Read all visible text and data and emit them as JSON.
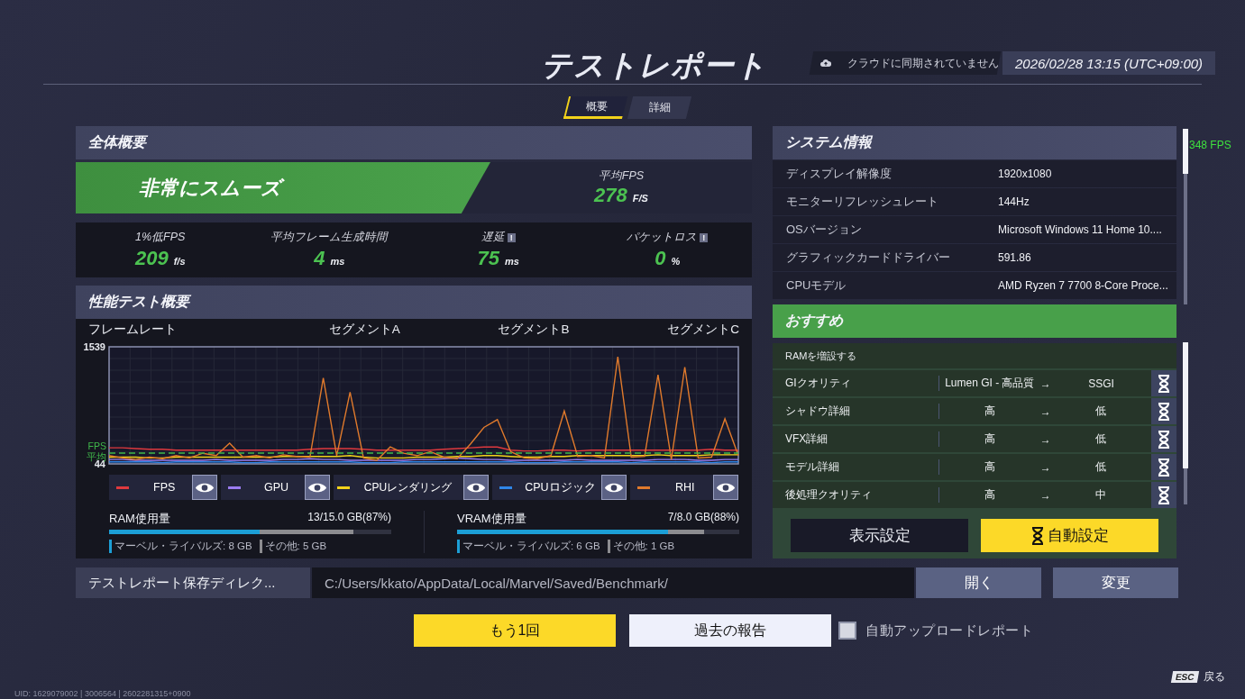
{
  "header": {
    "title": "テストレポート",
    "cloud_status": "クラウドに同期されていません",
    "datetime": "2026/02/28 13:15 (UTC+09:00)"
  },
  "tabs": [
    {
      "label": "概要",
      "selected": true
    },
    {
      "label": "詳細",
      "selected": false
    }
  ],
  "overview": {
    "title": "全体概要",
    "rating": "非常にスムーズ",
    "avg_fps": {
      "label": "平均FPS",
      "value": "278",
      "unit": "F/S"
    },
    "stats": [
      {
        "label": "1%低FPS",
        "value": "209",
        "unit": "f/s"
      },
      {
        "label": "平均フレーム生成時間",
        "value": "4",
        "unit": "ms"
      },
      {
        "label": "遅延",
        "badge": "!",
        "value": "75",
        "unit": "ms"
      },
      {
        "label": "パケットロス",
        "badge": "!",
        "value": "0",
        "unit": "%"
      }
    ]
  },
  "performance": {
    "title": "性能テスト概要",
    "average_label": "FPS 平均",
    "segments": [
      "セグメントA",
      "セグメントB",
      "セグメントC"
    ],
    "chart_data": {
      "type": "line",
      "title": "フレームレート",
      "ylim": [
        44,
        1539
      ],
      "yticks": [
        44,
        1539
      ],
      "grid": true,
      "series": [
        {
          "name": "FPS",
          "color": "#e0393e",
          "values": [
            250,
            250,
            240,
            230,
            230,
            220,
            220,
            220,
            220,
            220,
            220,
            220,
            220,
            220,
            220,
            230,
            240,
            240,
            240,
            230,
            220,
            220,
            220,
            220,
            220,
            230,
            240,
            250,
            260,
            260,
            220,
            210,
            210,
            220,
            220,
            210,
            220,
            220,
            220,
            220,
            220,
            220,
            220,
            220,
            220,
            230,
            220,
            220
          ]
        },
        {
          "name": "GPU",
          "color": "#9b7cf0",
          "values": [
            100,
            100,
            90,
            90,
            90,
            90,
            90,
            90,
            100,
            90,
            90,
            90,
            90,
            100,
            100,
            110,
            100,
            100,
            90,
            90,
            90,
            90,
            90,
            100,
            100,
            110,
            120,
            110,
            100,
            100,
            90,
            90,
            90,
            90,
            90,
            100,
            90,
            90,
            90,
            90,
            90,
            100,
            100,
            100,
            90,
            90,
            100,
            100
          ]
        },
        {
          "name": "CPUレンダリング",
          "color": "#f2d21b",
          "values": [
            130,
            130,
            130,
            120,
            120,
            130,
            130,
            130,
            130,
            130,
            130,
            130,
            130,
            140,
            140,
            140,
            140,
            140,
            150,
            130,
            120,
            120,
            120,
            130,
            130,
            130,
            140,
            140,
            150,
            150,
            140,
            130,
            130,
            140,
            140,
            150,
            150,
            150,
            150,
            150,
            150,
            160,
            150,
            150,
            150,
            160,
            160,
            160
          ]
        },
        {
          "name": "CPUロジック",
          "color": "#2f86e8",
          "values": [
            70,
            70,
            70,
            70,
            60,
            70,
            70,
            70,
            70,
            70,
            60,
            60,
            70,
            70,
            70,
            70,
            70,
            70,
            70,
            60,
            60,
            60,
            70,
            70,
            70,
            70,
            70,
            70,
            70,
            70,
            70,
            60,
            60,
            60,
            70,
            70,
            70,
            70,
            70,
            60,
            70,
            70,
            70,
            70,
            70,
            60,
            70,
            70
          ]
        },
        {
          "name": "RHI",
          "color": "#e07a2c",
          "values": [
            150,
            120,
            100,
            130,
            110,
            150,
            120,
            180,
            150,
            310,
            130,
            150,
            120,
            160,
            140,
            130,
            1140,
            150,
            960,
            120,
            90,
            260,
            180,
            150,
            200,
            130,
            110,
            300,
            510,
            610,
            200,
            120,
            110,
            150,
            720,
            140,
            150,
            120,
            1410,
            130,
            140,
            1180,
            100,
            1280,
            120,
            130,
            620,
            150
          ]
        }
      ]
    },
    "memory": [
      {
        "label": "RAM使用量",
        "reading": "13/15.0 GB(87%)",
        "level": 0.867,
        "parts": [
          {
            "label": "マーベル・ライバルズ: 8 GB",
            "level": 0.534,
            "color": "#1c9fd6"
          },
          {
            "label": "その他: 5 GB",
            "color": "#8c8c90"
          }
        ]
      },
      {
        "label": "VRAM使用量",
        "reading": "7/8.0 GB(88%)",
        "level": 0.875,
        "parts": [
          {
            "label": "マーベル・ライバルズ: 6 GB",
            "level": 0.749,
            "color": "#1c9fd6"
          },
          {
            "label": "その他: 1 GB",
            "color": "#8c8c90"
          }
        ]
      }
    ]
  },
  "system_info": {
    "title": "システム情報",
    "rows": [
      {
        "label": "ディスプレイ解像度",
        "value": "1920x1080"
      },
      {
        "label": "モニターリフレッシュレート",
        "value": "144Hz"
      },
      {
        "label": "OSバージョン",
        "value": "Microsoft Windows 11 Home 10...."
      },
      {
        "label": "グラフィックカードドライバー",
        "value": "591.86"
      },
      {
        "label": "CPUモデル",
        "value": "AMD Ryzen 7 7700 8-Core Proce..."
      }
    ]
  },
  "fps_overlay": "348 FPS",
  "recommend": {
    "title": "おすすめ",
    "note": "RAMを増設する",
    "rows": [
      {
        "setting": "GIクオリティ",
        "from": "Lumen GI - 高品質",
        "arrow": "→",
        "to": "SSGI"
      },
      {
        "setting": "シャドウ詳細",
        "from": "高",
        "arrow": "→",
        "to": "低"
      },
      {
        "setting": "VFX詳細",
        "from": "高",
        "arrow": "→",
        "to": "低"
      },
      {
        "setting": "モデル詳細",
        "from": "高",
        "arrow": "→",
        "to": "低"
      },
      {
        "setting": "後処理クオリティ",
        "from": "高",
        "arrow": "→",
        "to": "中"
      }
    ],
    "buttons": [
      {
        "kind": "dark",
        "label": "表示設定"
      },
      {
        "kind": "auto",
        "label": "自動設定"
      }
    ]
  },
  "directory": {
    "label": "テストレポート保存ディレク...",
    "path": "C:/Users/kkato/AppData/Local/Marvel/Saved/Benchmark/",
    "buttons": [
      "開く",
      "変更"
    ]
  },
  "actions": {
    "retry": "もう1回",
    "history": "過去の報告",
    "auto_upload": {
      "label": "自動アップロードレポート",
      "checked": false
    }
  },
  "footer": {
    "uid": "UID: 1629079002 | 3006564 | 2602281315+0900",
    "key": "ESC",
    "back": "戻る"
  }
}
